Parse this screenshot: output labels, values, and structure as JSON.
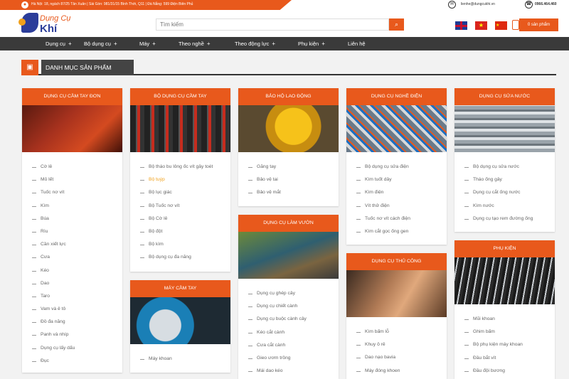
{
  "topbar": {
    "address": "Hà Nội: 18, ngách 87/25 Tân Xuân | Sài Gòn: 981/31/15 Bình Thới, Q11 | Đà Nẵng: 599 Điện Biên Phủ",
    "email": "lienhe@dungcukhi.vn",
    "phone": "0966.464.460"
  },
  "logo": {
    "line1": "Dụng Cụ",
    "line2": "Khí"
  },
  "search": {
    "placeholder": "Tìm kiếm",
    "icon": "search-icon"
  },
  "cart": {
    "label": "0 sản phẩm"
  },
  "nav": {
    "items": [
      "Dụng cụ",
      "Bộ dụng cụ",
      "Máy",
      "Theo nghề",
      "Theo động lực",
      "Phụ kiện",
      "Liên hệ"
    ],
    "plus": "+"
  },
  "section_title": "DANH MỤC SẢN PHẨM",
  "colors": {
    "accent": "#e8591c",
    "nav": "#3a3a3a",
    "active": "#f0a01a"
  },
  "categories": [
    {
      "title": "DỤNG CỤ CẦM TAY ĐƠN",
      "items": [
        "Cờ lê",
        "Mỏ lết",
        "Tuốc nơ vít",
        "Kìm",
        "Búa",
        "Rìu",
        "Cần xiết lực",
        "Cưa",
        "Kéo",
        "Dao",
        "Taro",
        "Vam và ê tô",
        "Đồ đa năng",
        "Panh và nhíp",
        "Dụng cụ lấy dấu",
        "Đục"
      ]
    },
    {
      "title": "BỘ DỤNG CỤ CẦM TAY",
      "items": [
        "Bộ tháo bu lông ốc vít gây toét",
        "Bộ tuýp",
        "Bộ lục giác",
        "Bộ Tuốc nơ vít",
        "Bộ Cờ lê",
        "Bộ đột",
        "Bộ kìm",
        "Bộ dụng cụ đa năng"
      ],
      "active": 1
    },
    {
      "title": "MÁY CẦM TAY",
      "items": [
        "Máy khoan"
      ]
    },
    {
      "title": "BẢO HỘ LAO ĐỘNG",
      "items": [
        "Găng tay",
        "Bảo vệ tai",
        "Bảo vệ mắt"
      ]
    },
    {
      "title": "DỤNG CỤ LÀM VƯỜN",
      "items": [
        "Dụng cụ ghép cây",
        "Dụng cụ chiết cành",
        "Dụng cụ buộc cành cây",
        "Kéo cắt cành",
        "Cưa cắt cành",
        "Gieo ươm trồng",
        "Mái dao kéo"
      ]
    },
    {
      "title": "DỤNG CỤ NGHỀ ĐIỆN",
      "items": [
        "Bộ dụng cụ sửa điện",
        "Kìm tuốt dây",
        "Kìm điện",
        "Vít thử điện",
        "Tuốc nơ vít cách điện",
        "Kìm cắt gọc ống gen"
      ]
    },
    {
      "title": "DỤNG CỤ THỦ CÔNG",
      "items": [
        "Kìm bấm lỗ",
        "Khuy ô rê",
        "Dao nạo bavia",
        "Máy đóng khoen"
      ]
    },
    {
      "title": "DỤNG CỤ SỬA NƯỚC",
      "items": [
        "Bộ dụng cụ sửa nước",
        "Tháo ống gây",
        "Dụng cụ cắt ống nước",
        "Kìm nước",
        "Dụng cụ tạo rem đường ống"
      ]
    },
    {
      "title": "PHỤ KIỆN",
      "items": [
        "Mũi khoan",
        "Ghim bấm",
        "Bộ phụ kiện máy khoan",
        "Đầu bắt vít",
        "Đầu đội bương"
      ]
    }
  ]
}
